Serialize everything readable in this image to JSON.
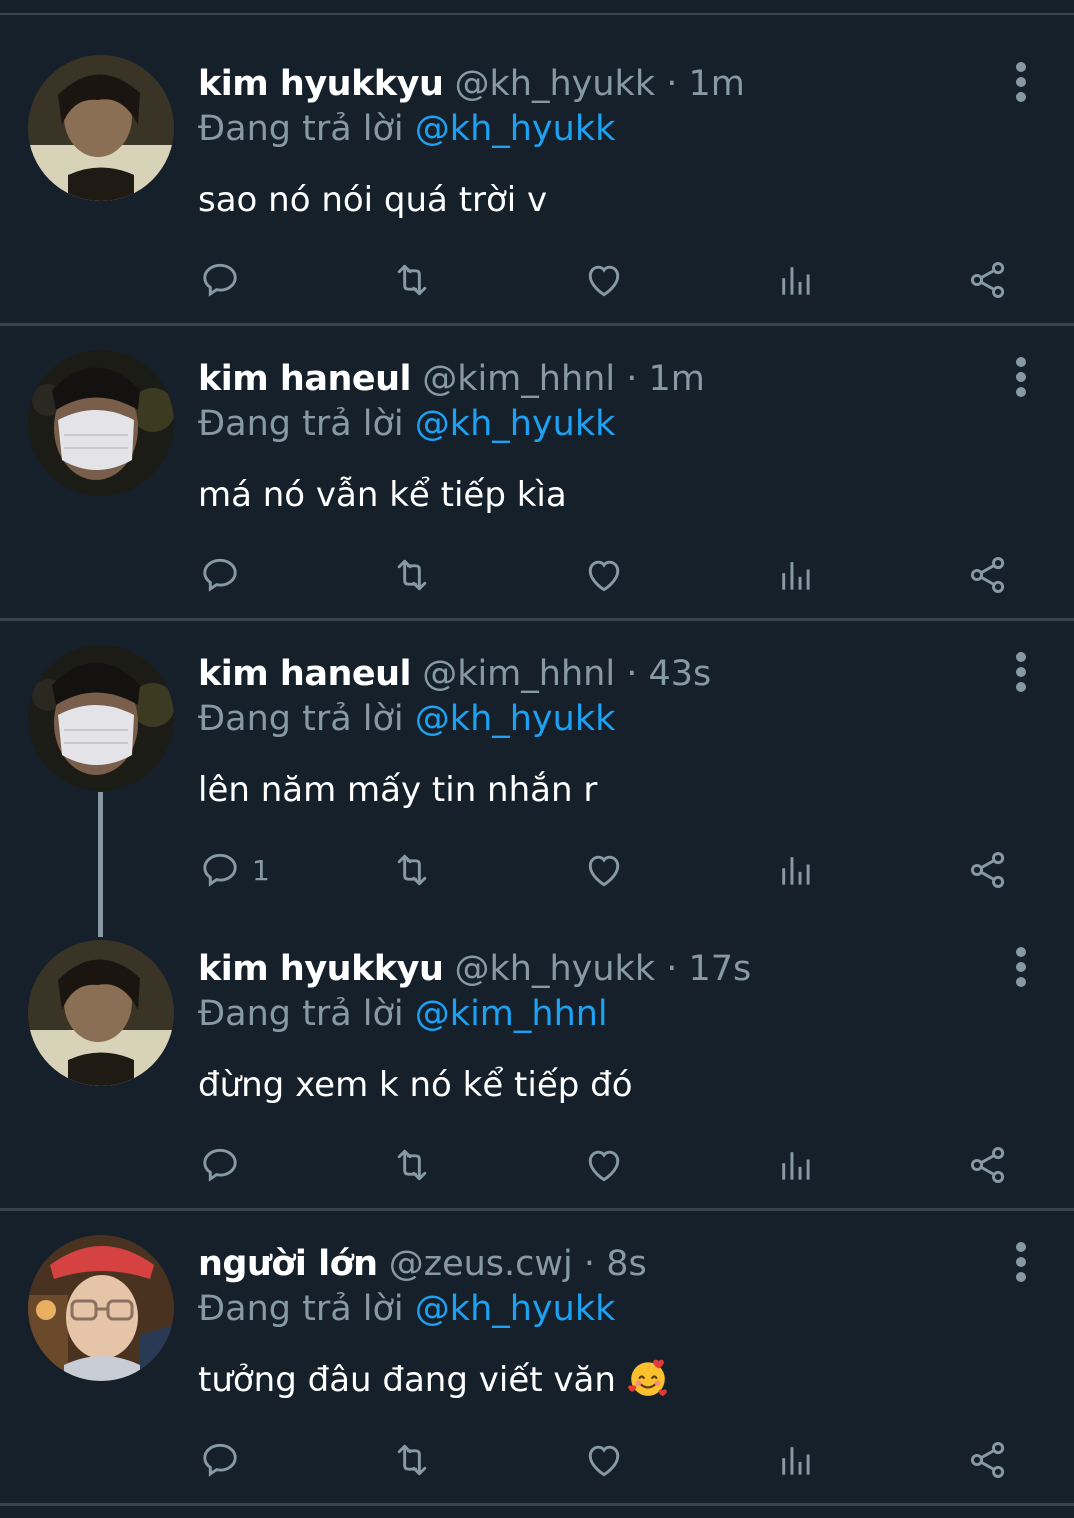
{
  "colors": {
    "background": "#15202b",
    "divider": "#38444d",
    "muted": "#8899a6",
    "link": "#1da1f2",
    "text": "#ffffff"
  },
  "tweets": [
    {
      "name": "kim hyukkyu",
      "handle": "@kh_hyukk",
      "dot": "·",
      "time": "1m",
      "reply_prefix": "Đang trả lời",
      "reply_to": "@kh_hyukk",
      "text": "sao nó nói quá trời v",
      "reply_count": ""
    },
    {
      "name": "kim haneul",
      "handle": "@kim_hhnl",
      "dot": "·",
      "time": "1m",
      "reply_prefix": "Đang trả lời",
      "reply_to": "@kh_hyukk",
      "text": "má nó vẫn kể tiếp kìa",
      "reply_count": ""
    },
    {
      "name": "kim haneul",
      "handle": "@kim_hhnl",
      "dot": "·",
      "time": "43s",
      "reply_prefix": "Đang trả lời",
      "reply_to": "@kh_hyukk",
      "text": "lên năm mấy tin nhắn r",
      "reply_count": "1"
    },
    {
      "name": "kim hyukkyu",
      "handle": "@kh_hyukk",
      "dot": "·",
      "time": "17s",
      "reply_prefix": "Đang trả lời",
      "reply_to": "@kim_hhnl",
      "text": "đừng xem k nó kể tiếp đó",
      "reply_count": ""
    },
    {
      "name": "người lớn",
      "handle": "@zeus.cwj",
      "dot": "·",
      "time": "8s",
      "reply_prefix": "Đang trả lời",
      "reply_to": "@kh_hyukk",
      "text": "tưởng đâu đang viết văn",
      "emoji": "smiling-face-with-hearts",
      "reply_count": ""
    }
  ],
  "icons": {
    "reply": "reply-icon",
    "retweet": "retweet-icon",
    "like": "heart-icon",
    "analytics": "analytics-icon",
    "share": "share-icon",
    "more": "more-vertical-icon"
  }
}
